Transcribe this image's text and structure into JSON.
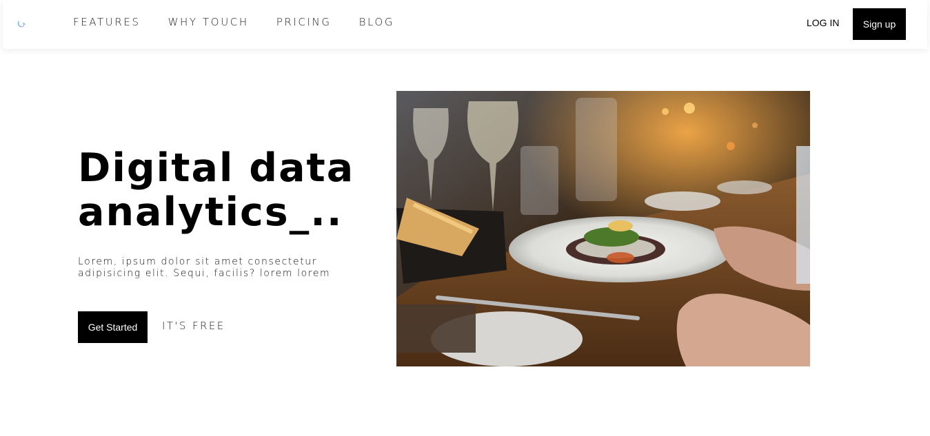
{
  "nav": {
    "links": [
      "FEATURES",
      "WHY TOUCH",
      "PRICING",
      "BLOG"
    ],
    "login_label": "LOG IN",
    "signup_label": "Sign up"
  },
  "hero": {
    "title_line1": "Digital data",
    "title_line2": "analytics_..",
    "subtitle": "Lorem, ipsum dolor sit amet consectetur adipisicing elit. Sequi, facilis? lorem lorem",
    "cta_label": "Get Started",
    "cta_note": "IT'S FREE"
  },
  "colors": {
    "primary": "#000000",
    "background": "#ffffff",
    "logo_accent": "#7fb3e0"
  },
  "icons": {
    "logo": "brand-logo-icon"
  }
}
